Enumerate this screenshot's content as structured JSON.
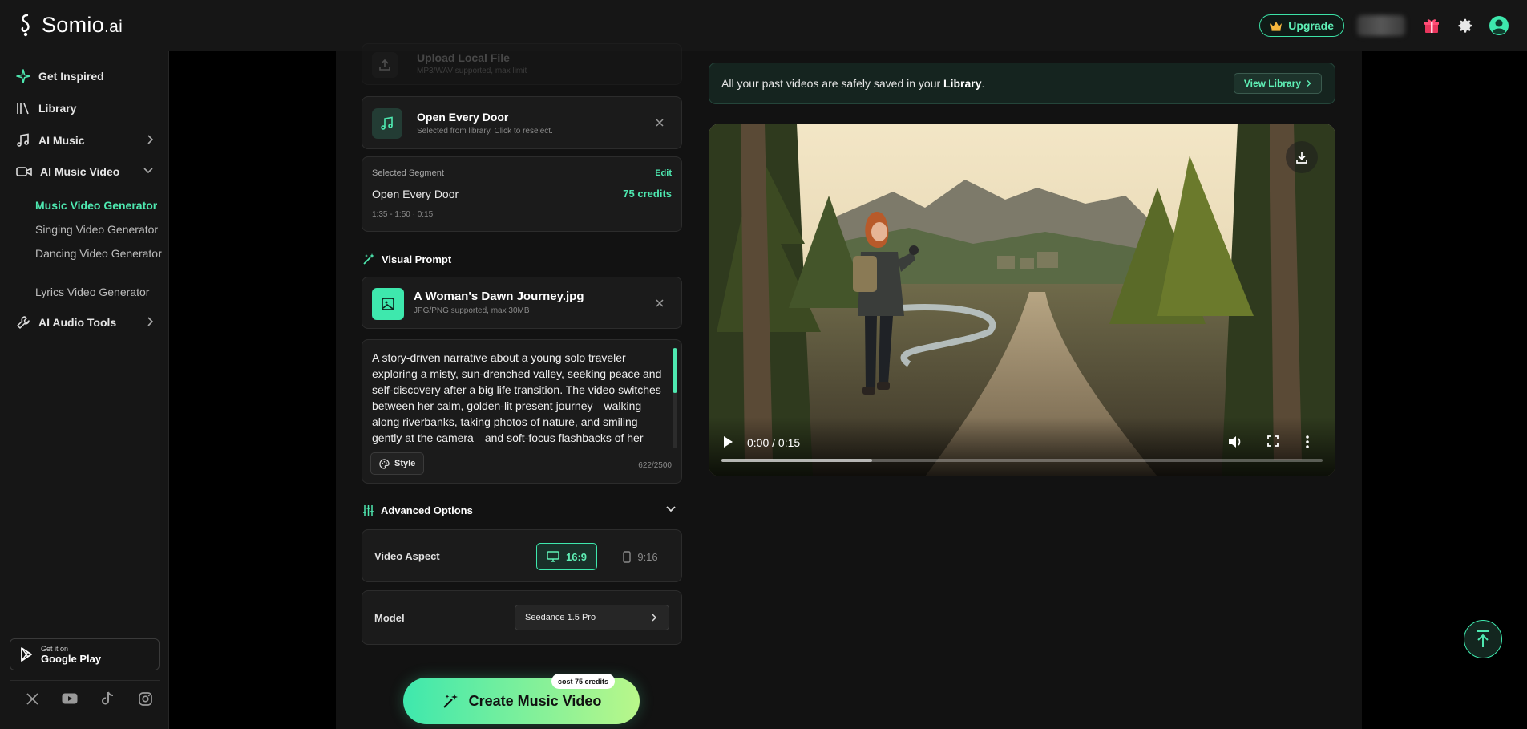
{
  "brand": {
    "name": "Somio",
    "suffix": ".ai"
  },
  "header": {
    "upgrade_label": "Upgrade",
    "icons": [
      "crown-icon",
      "gift-icon",
      "gear-icon",
      "avatar-icon"
    ]
  },
  "sidebar": {
    "items": [
      {
        "label": "Get Inspired",
        "icon": "sparkle-icon"
      },
      {
        "label": "Library",
        "icon": "library-icon"
      },
      {
        "label": "AI Music",
        "icon": "music-note-icon"
      },
      {
        "label": "AI Music Video",
        "icon": "video-camera-icon"
      },
      {
        "label": "AI Audio Tools",
        "icon": "wrench-icon"
      }
    ],
    "sub_items": [
      {
        "label": "Music Video Generator",
        "active": true
      },
      {
        "label": "Singing Video Generator",
        "active": false
      },
      {
        "label": "Dancing Video Generator",
        "active": false
      },
      {
        "label": "Lyrics Video Generator",
        "active": false
      }
    ],
    "google_play": {
      "small": "Get it on",
      "big": "Google Play"
    },
    "socials": [
      "x-icon",
      "youtube-icon",
      "tiktok-icon",
      "instagram-icon"
    ]
  },
  "upload": {
    "title": "Upload Local File",
    "hint": "MP3/WAV supported, max limit"
  },
  "song": {
    "title": "Open Every Door",
    "hint": "Selected from library. Click to reselect."
  },
  "segment": {
    "label": "Selected Segment",
    "edit": "Edit",
    "name": "Open Every Door",
    "credits": "75 credits",
    "time": "1:35 - 1:50 · 0:15"
  },
  "visual_prompt": {
    "title": "Visual Prompt",
    "image_name": "A Woman's Dawn Journey.jpg",
    "image_hint": "JPG/PNG supported, max 30MB",
    "text": "A story-driven narrative about a young solo traveler exploring a misty, sun-drenched valley, seeking peace and self-discovery after a big life transition. The video switches between her calm, golden-lit present journey—walking along riverbanks, taking photos of nature, and smiling gently at the camera—and soft-focus flashbacks of her",
    "style_label": "Style",
    "count": "622/2500"
  },
  "advanced": {
    "title": "Advanced Options",
    "aspect_label": "Video Aspect",
    "aspect_options": [
      "16:9",
      "9:16"
    ],
    "aspect_selected": "16:9",
    "model_label": "Model",
    "model_value": "Seedance 1.5 Pro"
  },
  "create": {
    "label": "Create Music Video",
    "cost": "cost 75 credits"
  },
  "library_notice": {
    "text_before": "All your past videos are safely saved in your ",
    "text_bold": "Library",
    "text_after": ".",
    "button": "View Library"
  },
  "player": {
    "time": "0:00 / 0:15",
    "buffered_fraction": 0.25
  },
  "colors": {
    "accent": "#3ee8ad",
    "accent_light": "#b9f78a",
    "bg": "#121212",
    "card": "#1b1b1b"
  }
}
